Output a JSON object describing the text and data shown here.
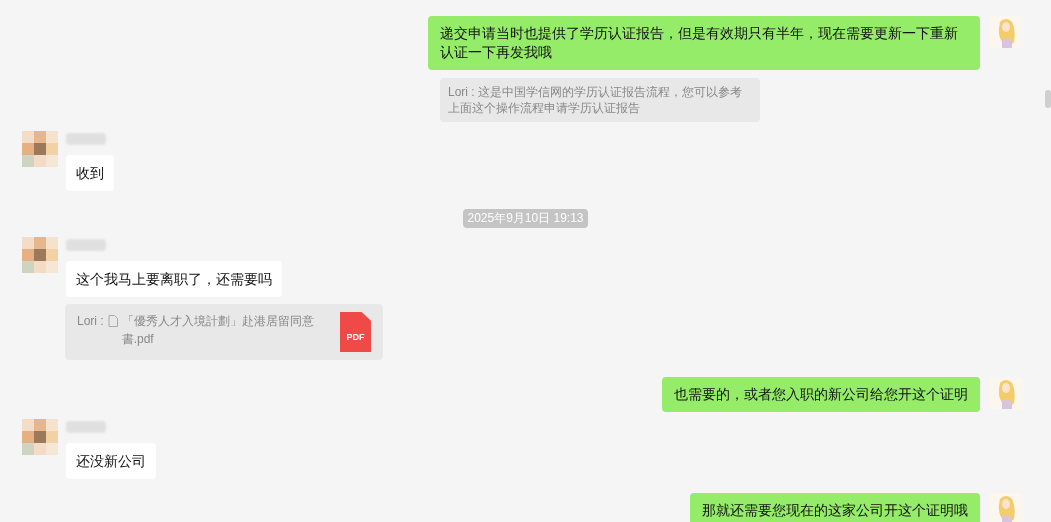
{
  "messages": [
    {
      "kind": "outgoing",
      "text": "递交申请当时也提供了学历认证报告，但是有效期只有半年，现在需要更新一下重新认证一下再发我哦"
    },
    {
      "kind": "quote",
      "text": "Lori : 这是中国学信网的学历认证报告流程，您可以参考上面这个操作流程申请学历认证报告"
    },
    {
      "kind": "incoming",
      "text": "收到"
    },
    {
      "kind": "timestamp",
      "text": "2025年9月10日 19:13"
    },
    {
      "kind": "incoming",
      "text": "这个我马上要离职了，还需要吗"
    },
    {
      "kind": "file_quote",
      "prefix": "Lori :",
      "filename": "「優秀人才入境計劃」赴港居留同意書.pdf",
      "badge": "PDF"
    },
    {
      "kind": "outgoing",
      "text": "也需要的，或者您入职的新公司给您开这个证明"
    },
    {
      "kind": "incoming",
      "text": "还没新公司"
    },
    {
      "kind": "outgoing",
      "text": "那就还需要您现在的这家公司开这个证明哦"
    }
  ]
}
